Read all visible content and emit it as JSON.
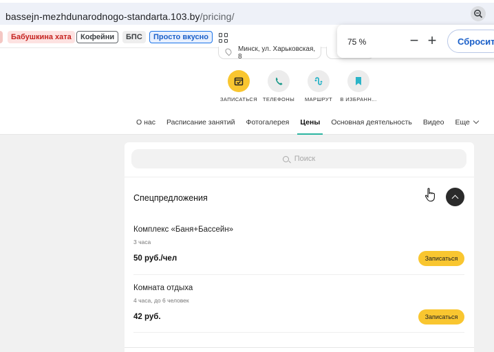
{
  "browser": {
    "url_host": "bassejn-mezhdunarodnogo-standarta.103.by",
    "url_path": "/pricing/"
  },
  "bookmarks": [
    {
      "label": "Бабушкина хата"
    },
    {
      "label": "Кофейни"
    },
    {
      "label": "БПС"
    },
    {
      "label": "Просто вкусно"
    }
  ],
  "zoom_popup": {
    "level": "75 %",
    "reset_label": "Сбросить"
  },
  "header": {
    "address": "Минск, ул. Харьковская, 8",
    "actions": [
      {
        "label": "ЗАПИСАТЬСЯ",
        "icon": "calendar-icon"
      },
      {
        "label": "ТЕЛЕФОНЫ",
        "icon": "phone-icon"
      },
      {
        "label": "МАРШРУТ",
        "icon": "route-icon"
      },
      {
        "label": "В ИЗБРАНН...",
        "icon": "bookmark-icon"
      }
    ],
    "tabs": [
      {
        "label": "О нас"
      },
      {
        "label": "Расписание занятий"
      },
      {
        "label": "Фотогалерея"
      },
      {
        "label": "Цены",
        "active": true
      },
      {
        "label": "Основная деятельность"
      },
      {
        "label": "Видео"
      },
      {
        "label": "Еще"
      }
    ]
  },
  "main": {
    "search_placeholder": "Поиск",
    "section_title": "Спецпредложения",
    "items": [
      {
        "name": "Комплекс «Баня+Бассейн»",
        "details": "3 часа",
        "price": "50 руб./чел",
        "button": "Записаться"
      },
      {
        "name": "Комната отдыха",
        "details": "4 часа, до 6 человек",
        "price": "42 руб.",
        "button": "Записаться"
      }
    ]
  },
  "colors": {
    "accent_yellow": "#f9c630",
    "active_tab_underline": "#2bb4a0",
    "phone_icon": "#1a9a8a",
    "route_icon": "#2bb4c8",
    "bookmark_icon": "#2bb4c8"
  }
}
